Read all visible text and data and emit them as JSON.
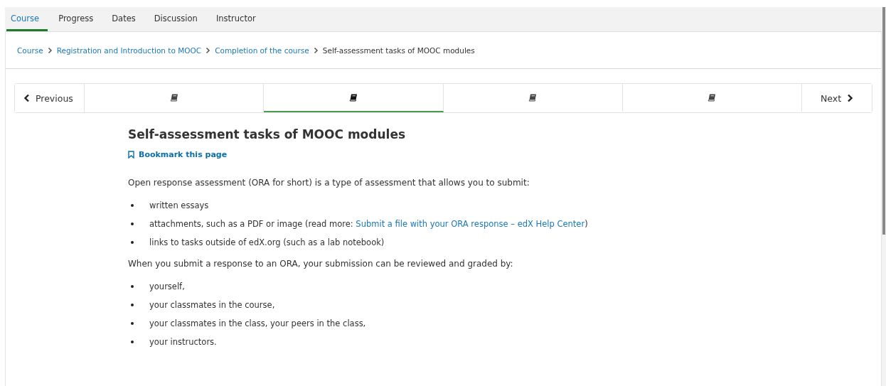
{
  "tabs": [
    {
      "label": "Course",
      "selected": true
    },
    {
      "label": "Progress",
      "selected": false
    },
    {
      "label": "Dates",
      "selected": false
    },
    {
      "label": "Discussion",
      "selected": false
    },
    {
      "label": "Instructor",
      "selected": false
    }
  ],
  "breadcrumb": [
    {
      "label": "Course",
      "kind": "link"
    },
    {
      "label": "Registration and Introduction to MOOC",
      "kind": "link"
    },
    {
      "label": "Completion of the course",
      "kind": "link"
    },
    {
      "label": "Self-assessment tasks of MOOC modules",
      "kind": "current"
    }
  ],
  "sequence_nav": {
    "previous": "Previous",
    "next": "Next",
    "units": [
      {
        "selected": false
      },
      {
        "selected": true
      },
      {
        "selected": false
      },
      {
        "selected": false
      }
    ]
  },
  "title": "Self-assessment tasks of MOOC modules",
  "bookmark": "Bookmark this page",
  "content": [
    {
      "kind": "paragraph",
      "text": "Open response assessment (ORA for short) is a type of assessment that allows you to submit:"
    },
    {
      "kind": "list",
      "items": [
        {
          "text": "written essays"
        },
        {
          "text": "attachments, such as a PDF or image (read more: ",
          "link": "Submit a file with your ORA response – edX Help Center",
          "after": ")"
        },
        {
          "text": "links to tasks outside of edX.org (such as a lab notebook)"
        }
      ]
    },
    {
      "kind": "paragraph",
      "text": "When you submit a response to an ORA, your submission can be reviewed and graded by:"
    },
    {
      "kind": "list",
      "items": [
        {
          "text": "yourself,"
        },
        {
          "text": "your classmates in the course,"
        },
        {
          "text": "your classmates in the class, your peers in the class,"
        },
        {
          "text": "your instructors."
        }
      ]
    }
  ]
}
